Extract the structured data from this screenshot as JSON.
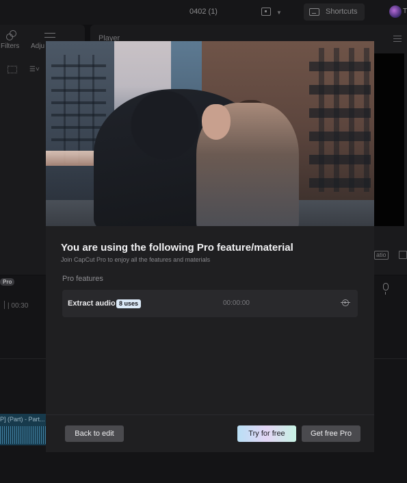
{
  "app": {
    "document_title": "0402 (1)",
    "shortcuts_label": "Shortcuts",
    "avatar_text": "T"
  },
  "left_panel": {
    "filters_label": "Filters",
    "adjust_label": "Adju"
  },
  "player": {
    "label": "Player",
    "ratio_label": "atio"
  },
  "timeline": {
    "pro_badge": "Pro",
    "ruler_time": "| 00:30",
    "clip_label": "P] (Part) - Part..."
  },
  "modal": {
    "title": "You are using the following Pro feature/material",
    "subtitle": "Join CapCut Pro to enjoy all the features and materials",
    "section_label": "Pro features",
    "features": [
      {
        "name": "Extract audio",
        "uses": "8 uses",
        "time": "00:00:00"
      }
    ],
    "buttons": {
      "back": "Back to edit",
      "try": "Try for free",
      "get_pro": "Get free Pro"
    }
  },
  "colors": {
    "background": "#101012",
    "modal_bg": "#1f1f21",
    "uses_badge": "#dbe9f7",
    "try_gradient": [
      "#b9dff5",
      "#e3d6f5",
      "#c7f2e4"
    ],
    "button_gray": "#4a4a4e"
  },
  "icons": [
    "layout-icon",
    "keyboard-icon",
    "filters-icon",
    "adjust-icon",
    "grid-icon",
    "sort-icon",
    "menu-icon",
    "fullscreen-icon",
    "microphone-icon",
    "locate-icon"
  ]
}
